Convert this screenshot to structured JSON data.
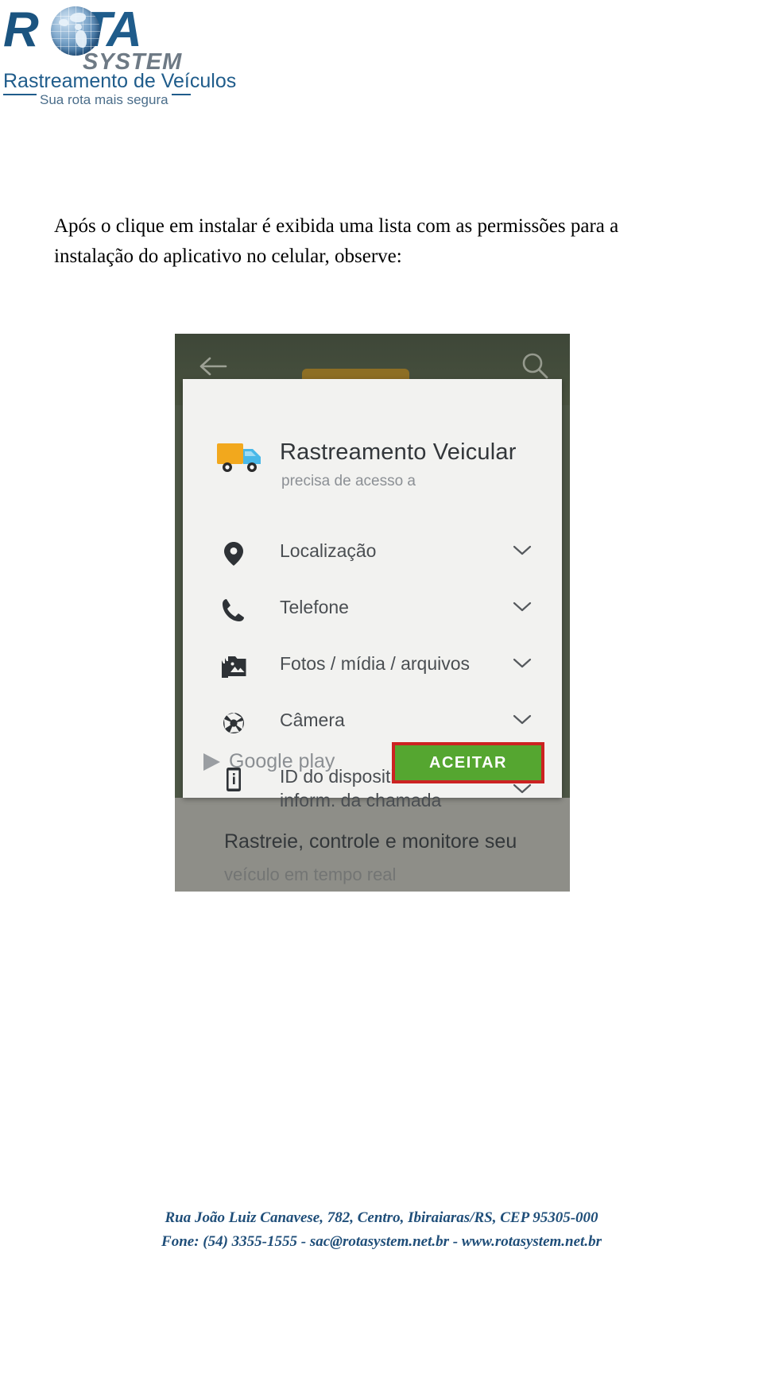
{
  "logo": {
    "brand_primary": "ROTA",
    "brand_primary_pre": "R",
    "brand_primary_post": "TA",
    "brand_secondary": "SYSTEM",
    "tagline_1": "Rastreamento de Veículos",
    "tagline_2": "Sua rota mais segura",
    "color_primary": "#1f5c8b",
    "color_secondary": "#6e7a85"
  },
  "document": {
    "paragraph_line_1": "Após o clique em instalar é exibida uma lista com as permissões para a",
    "paragraph_line_2": "instalação do aplicativo no celular, observe:"
  },
  "screenshot": {
    "statusbar": {
      "back_icon": "back-arrow-icon",
      "search_icon": "search-icon"
    },
    "dialog": {
      "app_icon": "truck-icon",
      "title": "Rastreamento Veicular",
      "subtitle": "precisa de acesso a",
      "permissions": [
        {
          "icon": "location-pin-icon",
          "label": "Localização",
          "expand_icon": "chevron-down-icon"
        },
        {
          "icon": "phone-icon",
          "label": "Telefone",
          "expand_icon": "chevron-down-icon"
        },
        {
          "icon": "photos-media-icon",
          "label": "Fotos / mídia / arquivos",
          "expand_icon": "chevron-down-icon"
        },
        {
          "icon": "camera-aperture-icon",
          "label": "Câmera",
          "expand_icon": "chevron-down-icon"
        },
        {
          "icon": "device-info-icon",
          "label": "ID do dispositivo e\ninform. da chamada",
          "expand_icon": "chevron-down-icon"
        }
      ],
      "store_brand": "Google play",
      "store_icon": "google-play-triangle-icon",
      "accept_button": "ACEITAR",
      "accept_button_color": "#55a630",
      "accept_highlight_color": "#cc2222"
    },
    "page_caption": "Rastreie, controle e monitore seu",
    "page_caption_partial": "veículo em tempo real"
  },
  "footer": {
    "address": "Rua João Luiz Canavese, 782, Centro, Ibiraiaras/RS, CEP 95305-000",
    "contact": "Fone: (54) 3355-1555 - sac@rotasystem.net.br - www.rotasystem.net.br",
    "color": "#1f4e79"
  }
}
